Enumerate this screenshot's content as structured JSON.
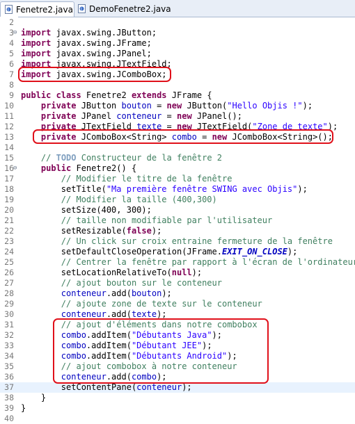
{
  "tabs": [
    {
      "label": "Fenetre2.java",
      "close": "✕",
      "active": true
    },
    {
      "label": "DemoFenetre2.java",
      "active": false
    }
  ],
  "lines": [
    {
      "n": "2",
      "fold": "",
      "tokens": []
    },
    {
      "n": "3",
      "fold": "⊖",
      "tokens": [
        [
          "kw",
          "import"
        ],
        [
          "",
          "javax.swing.JButton;"
        ]
      ]
    },
    {
      "n": "4",
      "fold": "",
      "tokens": [
        [
          "kw",
          "import"
        ],
        [
          "",
          "javax.swing.JFrame;"
        ]
      ]
    },
    {
      "n": "5",
      "fold": "",
      "tokens": [
        [
          "kw",
          "import"
        ],
        [
          "",
          "javax.swing.JPanel;"
        ]
      ]
    },
    {
      "n": "6",
      "fold": "",
      "tokens": [
        [
          "kw",
          "import"
        ],
        [
          "",
          "javax.swing.JTextField;"
        ]
      ]
    },
    {
      "n": "7",
      "fold": "",
      "tokens": [
        [
          "kw",
          "import"
        ],
        [
          "",
          "javax.swing.JComboBox;"
        ]
      ]
    },
    {
      "n": "8",
      "fold": "",
      "tokens": []
    },
    {
      "n": "9",
      "fold": "",
      "tokens": [
        [
          "kw",
          "public class"
        ],
        [
          "",
          "Fenetre2 "
        ],
        [
          "kw",
          "extends"
        ],
        [
          "",
          "JFrame {"
        ]
      ]
    },
    {
      "n": "10",
      "fold": "",
      "tokens": [
        [
          "",
          "    "
        ],
        [
          "kw",
          "private"
        ],
        [
          "",
          "JButton "
        ],
        [
          "fld",
          "bouton"
        ],
        [
          "",
          " = "
        ],
        [
          "kw",
          "new"
        ],
        [
          "",
          "JButton("
        ],
        [
          "str",
          "\"Hello Objis !\""
        ],
        [
          "",
          ");"
        ]
      ]
    },
    {
      "n": "11",
      "fold": "",
      "tokens": [
        [
          "",
          "    "
        ],
        [
          "kw",
          "private"
        ],
        [
          "",
          "JPanel "
        ],
        [
          "fld",
          "conteneur"
        ],
        [
          "",
          " = "
        ],
        [
          "kw",
          "new"
        ],
        [
          "",
          "JPanel();"
        ]
      ]
    },
    {
      "n": "12",
      "fold": "",
      "tokens": [
        [
          "",
          "    "
        ],
        [
          "kw",
          "private"
        ],
        [
          "",
          "JTextField "
        ],
        [
          "fld",
          "texte"
        ],
        [
          "",
          " = "
        ],
        [
          "kw",
          "new"
        ],
        [
          "",
          "JTextField("
        ],
        [
          "str",
          "\"Zone de texte\""
        ],
        [
          "",
          ");"
        ]
      ]
    },
    {
      "n": "13",
      "fold": "",
      "tokens": [
        [
          "",
          "    "
        ],
        [
          "kw",
          "private"
        ],
        [
          "",
          "JComboBox<String> "
        ],
        [
          "fld",
          "combo"
        ],
        [
          "",
          " = "
        ],
        [
          "kw",
          "new"
        ],
        [
          "",
          "JComboBox<String>();"
        ]
      ]
    },
    {
      "n": "14",
      "fold": "",
      "tokens": []
    },
    {
      "n": "15",
      "fold": "",
      "tokens": [
        [
          "",
          "    "
        ],
        [
          "cmt",
          "// "
        ],
        [
          "todo",
          "TODO"
        ],
        [
          "cmt",
          " Constructeur de la fenêtre 2"
        ]
      ]
    },
    {
      "n": "16",
      "fold": "⊖",
      "tokens": [
        [
          "",
          "    "
        ],
        [
          "kw",
          "public"
        ],
        [
          "",
          "Fenetre2() {"
        ]
      ]
    },
    {
      "n": "17",
      "fold": "",
      "tokens": [
        [
          "",
          "        "
        ],
        [
          "cmt",
          "// Modifier le titre de la fenêtre"
        ]
      ]
    },
    {
      "n": "18",
      "fold": "",
      "tokens": [
        [
          "",
          "        setTitle("
        ],
        [
          "str",
          "\"Ma première fenêtre SWING avec Objis\""
        ],
        [
          "",
          ");"
        ]
      ]
    },
    {
      "n": "19",
      "fold": "",
      "tokens": [
        [
          "",
          "        "
        ],
        [
          "cmt",
          "// Modifier la taille (400,300)"
        ]
      ]
    },
    {
      "n": "20",
      "fold": "",
      "tokens": [
        [
          "",
          "        setSize(400, 300);"
        ]
      ]
    },
    {
      "n": "21",
      "fold": "",
      "tokens": [
        [
          "",
          "        "
        ],
        [
          "cmt",
          "// taille non modifiable par l'utilisateur"
        ]
      ]
    },
    {
      "n": "22",
      "fold": "",
      "tokens": [
        [
          "",
          "        setResizable("
        ],
        [
          "kw",
          "false"
        ],
        [
          "",
          ");"
        ]
      ]
    },
    {
      "n": "23",
      "fold": "",
      "tokens": [
        [
          "",
          "        "
        ],
        [
          "cmt",
          "// Un click sur croix entraine fermeture de la fenêtre"
        ]
      ]
    },
    {
      "n": "24",
      "fold": "",
      "tokens": [
        [
          "",
          "        setDefaultCloseOperation(JFrame."
        ],
        [
          "const",
          "EXIT_ON_CLOSE"
        ],
        [
          "",
          ");"
        ]
      ]
    },
    {
      "n": "25",
      "fold": "",
      "tokens": [
        [
          "",
          "        "
        ],
        [
          "cmt",
          "// Centrer la fenêtre par rapport à l'écran de l'ordinateur"
        ]
      ]
    },
    {
      "n": "26",
      "fold": "",
      "tokens": [
        [
          "",
          "        setLocationRelativeTo("
        ],
        [
          "kw",
          "null"
        ],
        [
          "",
          ");"
        ]
      ]
    },
    {
      "n": "27",
      "fold": "",
      "tokens": [
        [
          "",
          "        "
        ],
        [
          "cmt",
          "// ajout bouton sur le conteneur"
        ]
      ]
    },
    {
      "n": "28",
      "fold": "",
      "tokens": [
        [
          "",
          "        "
        ],
        [
          "fld",
          "conteneur"
        ],
        [
          "",
          ".add("
        ],
        [
          "fld",
          "bouton"
        ],
        [
          "",
          ");"
        ]
      ]
    },
    {
      "n": "29",
      "fold": "",
      "tokens": [
        [
          "",
          "        "
        ],
        [
          "cmt",
          "// ajoute zone de texte sur le conteneur"
        ]
      ]
    },
    {
      "n": "30",
      "fold": "",
      "tokens": [
        [
          "",
          "        "
        ],
        [
          "fld",
          "conteneur"
        ],
        [
          "",
          ".add("
        ],
        [
          "fld",
          "texte"
        ],
        [
          "",
          ");"
        ]
      ]
    },
    {
      "n": "31",
      "fold": "",
      "tokens": [
        [
          "",
          "        "
        ],
        [
          "cmt",
          "// ajout d'éléments dans notre combobox"
        ]
      ]
    },
    {
      "n": "32",
      "fold": "",
      "tokens": [
        [
          "",
          "        "
        ],
        [
          "fld",
          "combo"
        ],
        [
          "",
          ".addItem("
        ],
        [
          "str",
          "\"Débutants Java\""
        ],
        [
          "",
          ");"
        ]
      ]
    },
    {
      "n": "33",
      "fold": "",
      "tokens": [
        [
          "",
          "        "
        ],
        [
          "fld",
          "combo"
        ],
        [
          "",
          ".addItem("
        ],
        [
          "str",
          "\"Débutant JEE\""
        ],
        [
          "",
          ");"
        ]
      ]
    },
    {
      "n": "34",
      "fold": "",
      "tokens": [
        [
          "",
          "        "
        ],
        [
          "fld",
          "combo"
        ],
        [
          "",
          ".addItem("
        ],
        [
          "str",
          "\"Débutants Android\""
        ],
        [
          "",
          ");"
        ]
      ]
    },
    {
      "n": "35",
      "fold": "",
      "tokens": [
        [
          "",
          "        "
        ],
        [
          "cmt",
          "// ajout combobox à notre conteneur"
        ]
      ]
    },
    {
      "n": "36",
      "fold": "",
      "tokens": [
        [
          "",
          "        "
        ],
        [
          "fld",
          "conteneur"
        ],
        [
          "",
          ".add("
        ],
        [
          "fld",
          "combo"
        ],
        [
          "",
          ");"
        ]
      ]
    },
    {
      "n": "37",
      "fold": "",
      "tokens": [
        [
          "",
          "        setContentPane("
        ],
        [
          "fld",
          "conteneur"
        ],
        [
          "",
          ");"
        ]
      ]
    },
    {
      "n": "38",
      "fold": "",
      "tokens": [
        [
          "",
          "    }"
        ]
      ]
    },
    {
      "n": "39",
      "fold": "",
      "tokens": [
        [
          "",
          "}"
        ]
      ]
    },
    {
      "n": "40",
      "fold": "",
      "tokens": []
    }
  ],
  "highlighted_line": "37",
  "colors": {
    "keyword": "#7f0055",
    "field": "#0000c0",
    "string": "#2a00ff",
    "comment": "#3f7f5f",
    "annotation_box": "#e0101a"
  }
}
